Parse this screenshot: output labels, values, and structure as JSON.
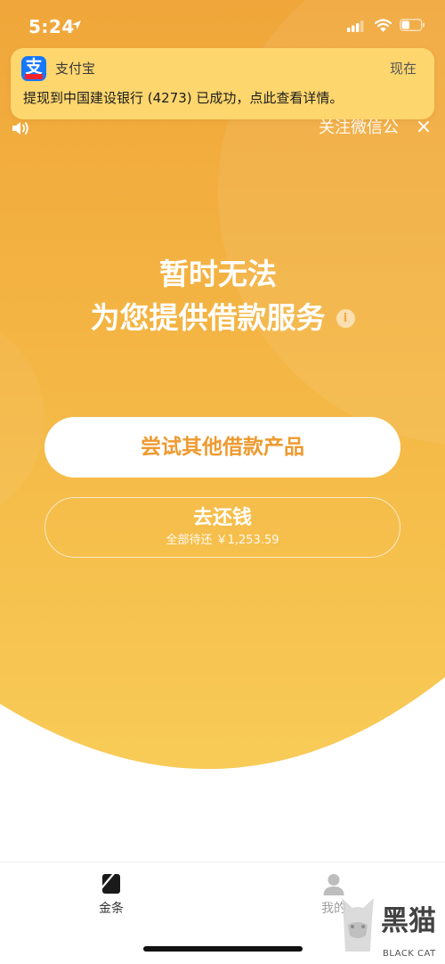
{
  "status_bar": {
    "time": "5:24",
    "battery_level": 0.4,
    "icons": [
      "location-arrow-icon",
      "signal-icon",
      "wifi-icon",
      "battery-icon"
    ]
  },
  "notification": {
    "app_name": "支付宝",
    "time": "现在",
    "message": "提现到中国建设银行 (4273) 已成功，点此查看详情。",
    "logo_glyph": "支",
    "icon": "alipay-icon"
  },
  "follow_banner": {
    "text": "关注微信公",
    "close": "×",
    "icons": [
      "speaker-icon",
      "close-icon"
    ]
  },
  "main": {
    "title_line1": "暂时无法",
    "title_line2": "为您提供借款服务",
    "info_glyph": "i"
  },
  "buttons": {
    "primary": "尝试其他借款产品",
    "repay_title": "去还钱",
    "repay_subtitle": "全部待还 ￥1,253.59"
  },
  "tabs": [
    {
      "label": "金条",
      "icon": "jintiao-icon",
      "active": true
    },
    {
      "label": "我的",
      "icon": "profile-icon",
      "active": false
    }
  ],
  "watermark": {
    "text": "黑猫",
    "subtext": "BLACK CAT"
  },
  "colors": {
    "background_top": "#F0A63A",
    "background_mid": "#F4B745",
    "background_bottom": "#F8CB57",
    "button_text": "#EE9A30",
    "notification_bg": "#FDD66E",
    "alipay_blue": "#1677FF",
    "tab_active": "#333333",
    "tab_inactive": "#9E9E9E"
  }
}
